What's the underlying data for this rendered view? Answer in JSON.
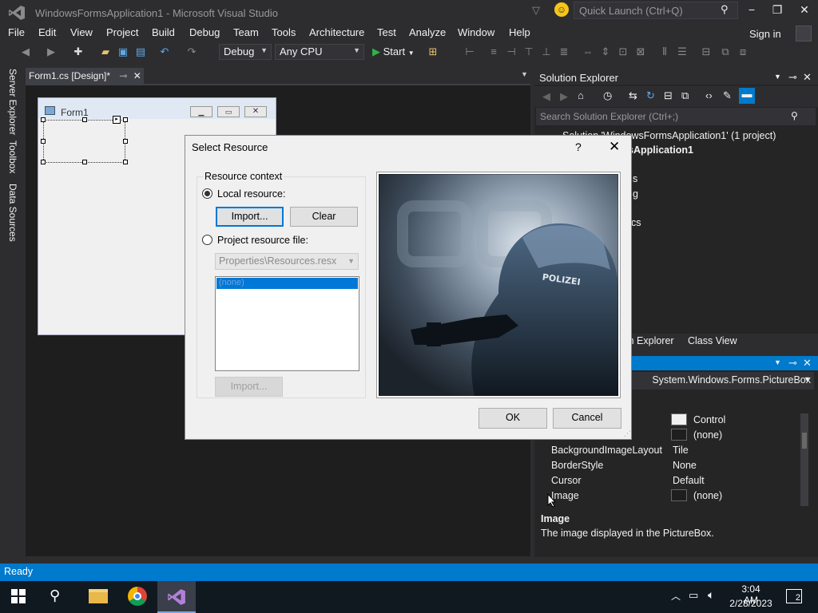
{
  "window": {
    "title": "WindowsFormsApplication1 - Microsoft Visual Studio"
  },
  "quick_launch": {
    "placeholder": "Quick Launch (Ctrl+Q)"
  },
  "menu": [
    "File",
    "Edit",
    "View",
    "Project",
    "Build",
    "Debug",
    "Team",
    "Tools",
    "Architecture",
    "Test",
    "Analyze",
    "Window",
    "Help"
  ],
  "sign_in": "Sign in",
  "toolbar": {
    "config": "Debug",
    "platform": "Any CPU",
    "start": "Start"
  },
  "left_tabs": [
    "Server Explorer",
    "Toolbox",
    "Data Sources"
  ],
  "document_tab": "Form1.cs [Design]*",
  "designer": {
    "form_title": "Form1"
  },
  "solution_explorer": {
    "title": "Solution Explorer",
    "search_placeholder": "Search Solution Explorer (Ctrl+;)",
    "rows": [
      "Solution 'WindowsFormsApplication1' (1 project)",
      "WindowsFormsApplication1"
    ],
    "partial_rows": [
      "s",
      "g",
      "cs"
    ],
    "tabs": [
      "Team Explorer",
      "Class View"
    ]
  },
  "properties": {
    "object": "System.Windows.Forms.PictureBox",
    "rows": [
      {
        "name": "",
        "value": "Control",
        "swatch": "#f0f0f0"
      },
      {
        "name": "",
        "value": "(none)",
        "swatch": "#1e1e1e"
      },
      {
        "name": "BackgroundImageLayout",
        "value": "Tile"
      },
      {
        "name": "BorderStyle",
        "value": "None"
      },
      {
        "name": "Cursor",
        "value": "Default"
      },
      {
        "name": "Image",
        "value": "(none)",
        "swatch": "#1e1e1e"
      }
    ],
    "description_title": "Image",
    "description_text": "The image displayed in the PictureBox."
  },
  "status": "Ready",
  "taskbar": {
    "time": "3:04 AM",
    "date": "2/28/2023",
    "notifications": "2"
  },
  "dialog": {
    "title": "Select Resource",
    "help": "?",
    "group_label": "Resource context",
    "local_resource": "Local resource:",
    "import_label": "Import...",
    "clear_label": "Clear",
    "project_resource": "Project resource file:",
    "resource_file": "Properties\\Resources.resx",
    "list_item": "(none)",
    "import_label_2": "Import...",
    "ok": "OK",
    "cancel": "Cancel",
    "preview_text": "POLIZEI"
  },
  "colors": {
    "accent": "#007acc",
    "background": "#2d2d30",
    "designer": "#1e1e1e"
  }
}
